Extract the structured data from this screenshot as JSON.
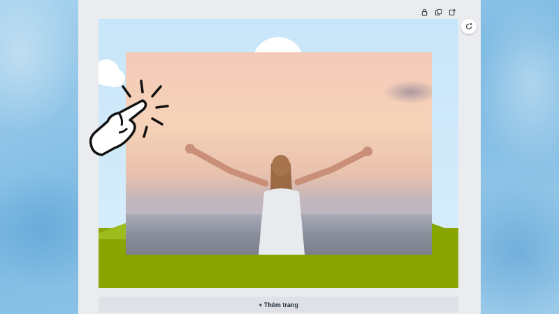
{
  "toolbar": {
    "icons": [
      "lock-icon",
      "duplicate-icon",
      "add-page-icon"
    ]
  },
  "side_action": {
    "icon": "refresh-plus-icon"
  },
  "add_page": {
    "label": "+ Thêm trang"
  },
  "overlay": {
    "icon": "tap-hand-icon"
  }
}
